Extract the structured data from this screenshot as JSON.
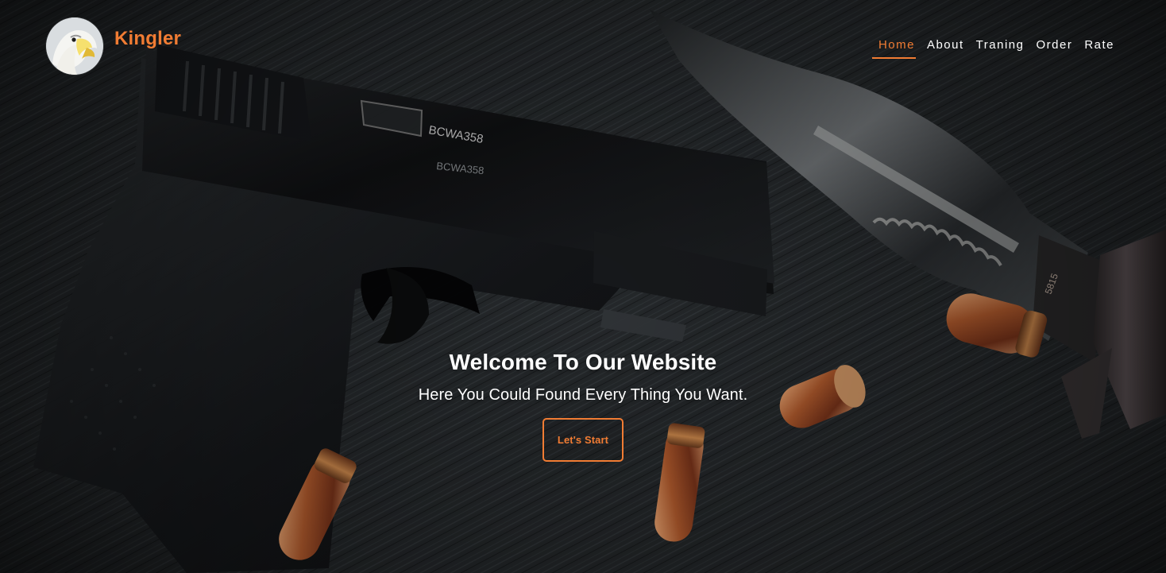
{
  "brand": {
    "name": "Kingler",
    "logo_icon": "eagle-icon",
    "color": "#f17c33"
  },
  "nav": {
    "items": [
      {
        "label": "Home",
        "active": true
      },
      {
        "label": "About",
        "active": false
      },
      {
        "label": "Traning",
        "active": false
      },
      {
        "label": "Order",
        "active": false
      },
      {
        "label": "Rate",
        "active": false
      }
    ],
    "active_color": "#f17c33"
  },
  "hero": {
    "title": "Welcome To Our Website",
    "subtitle": "Here You Could Found Every Thing You Want.",
    "button_label": "Let's Start",
    "background_theme": "dark fabric product scene",
    "pistol_marking": "BCWA358",
    "knife_marking": "5815"
  },
  "colors": {
    "accent": "#f17c33",
    "text": "#ffffff",
    "background": "#1f2225"
  }
}
